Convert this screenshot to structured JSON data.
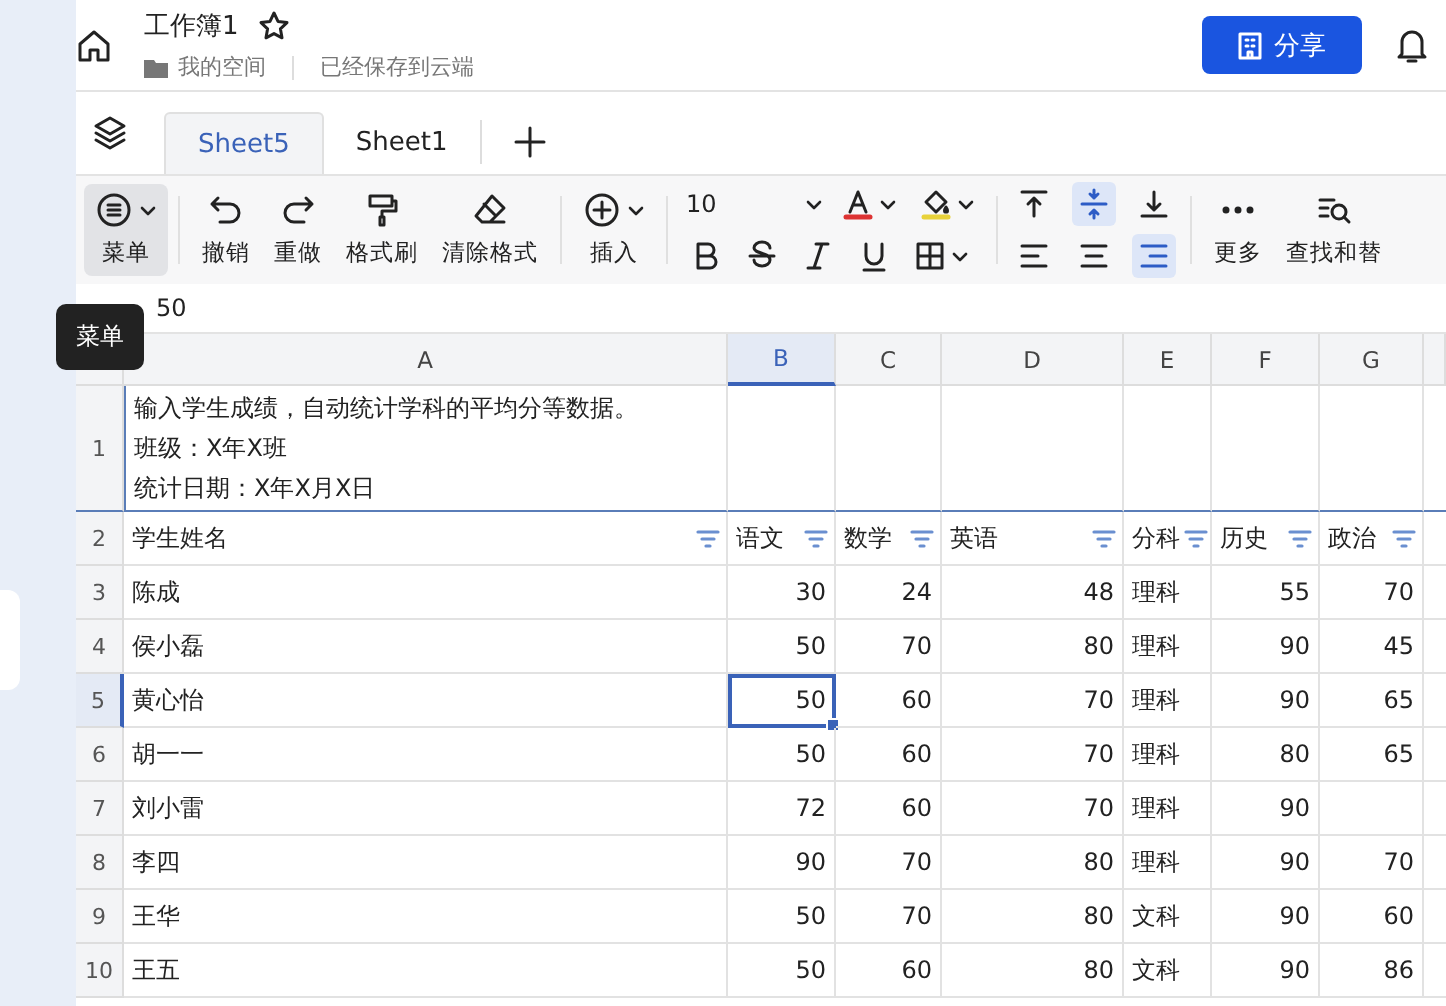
{
  "window": {
    "title": "工作簿1",
    "location": "我的空间",
    "save_status": "已经保存到云端"
  },
  "share_button": "分享",
  "sheet_tabs": [
    {
      "label": "Sheet5",
      "selected": true
    },
    {
      "label": "Sheet1",
      "selected": false
    }
  ],
  "toolbar": {
    "tools": [
      {
        "kind": "menu",
        "label": "菜单",
        "selected": true
      },
      {
        "kind": "undo",
        "label": "撤销",
        "selected": false
      },
      {
        "kind": "redo",
        "label": "重做",
        "selected": false
      },
      {
        "kind": "painter",
        "label": "格式刷",
        "selected": false
      },
      {
        "kind": "eraser",
        "label": "清除格式",
        "selected": false
      },
      {
        "kind": "insert",
        "label": "插入",
        "selected": false
      }
    ],
    "font_size": "10",
    "vertical_align": [
      {
        "kind": "top",
        "selected": false
      },
      {
        "kind": "middle",
        "selected": true
      },
      {
        "kind": "bottom",
        "selected": false
      }
    ],
    "horizontal_align": [
      {
        "kind": "left",
        "selected": false
      },
      {
        "kind": "center",
        "selected": false
      },
      {
        "kind": "right",
        "selected": true
      }
    ],
    "more": "更多",
    "find": "查找和替"
  },
  "formula_bar": {
    "value": "50"
  },
  "tooltip": "菜单",
  "sheet": {
    "columns": [
      {
        "label": "A",
        "numeric": false,
        "selected": false
      },
      {
        "label": "B",
        "numeric": true,
        "selected": true
      },
      {
        "label": "C",
        "numeric": true,
        "selected": false
      },
      {
        "label": "D",
        "numeric": true,
        "selected": false
      },
      {
        "label": "E",
        "numeric": false,
        "selected": false
      },
      {
        "label": "F",
        "numeric": true,
        "selected": false
      },
      {
        "label": "G",
        "numeric": true,
        "selected": false
      }
    ],
    "rows": [
      {
        "number": "1",
        "kind": "title",
        "selected": false,
        "cells": [
          [
            "输入学生成绩，自动统计学科的平均分等数据。",
            "班级：X年X班",
            "统计日期：X年X月X日"
          ]
        ]
      },
      {
        "number": "2",
        "kind": "header",
        "selected": false,
        "cells": [
          "学生姓名",
          "语文",
          "数学",
          "英语",
          "分科",
          "历史",
          "政治"
        ]
      },
      {
        "number": "3",
        "kind": "data",
        "selected": false,
        "cells": [
          "陈成",
          "30",
          "24",
          "48",
          "理科",
          "55",
          "70"
        ]
      },
      {
        "number": "4",
        "kind": "data",
        "selected": false,
        "cells": [
          "侯小磊",
          "50",
          "70",
          "80",
          "理科",
          "90",
          "45"
        ]
      },
      {
        "number": "5",
        "kind": "data",
        "selected": true,
        "cells": [
          "黄心怡",
          "50",
          "60",
          "70",
          "理科",
          "90",
          "65"
        ]
      },
      {
        "number": "6",
        "kind": "data",
        "selected": false,
        "cells": [
          "胡一一",
          "50",
          "60",
          "70",
          "理科",
          "80",
          "65"
        ]
      },
      {
        "number": "7",
        "kind": "data",
        "selected": false,
        "cells": [
          "刘小雷",
          "72",
          "60",
          "70",
          "理科",
          "90",
          ""
        ]
      },
      {
        "number": "8",
        "kind": "data",
        "selected": false,
        "cells": [
          "李四",
          "90",
          "70",
          "80",
          "理科",
          "90",
          "70"
        ]
      },
      {
        "number": "9",
        "kind": "data",
        "selected": false,
        "cells": [
          "王华",
          "50",
          "70",
          "80",
          "文科",
          "90",
          "60"
        ]
      },
      {
        "number": "10",
        "kind": "data",
        "selected": false,
        "cells": [
          "王五",
          "50",
          "60",
          "80",
          "文科",
          "90",
          "86"
        ]
      }
    ]
  }
}
